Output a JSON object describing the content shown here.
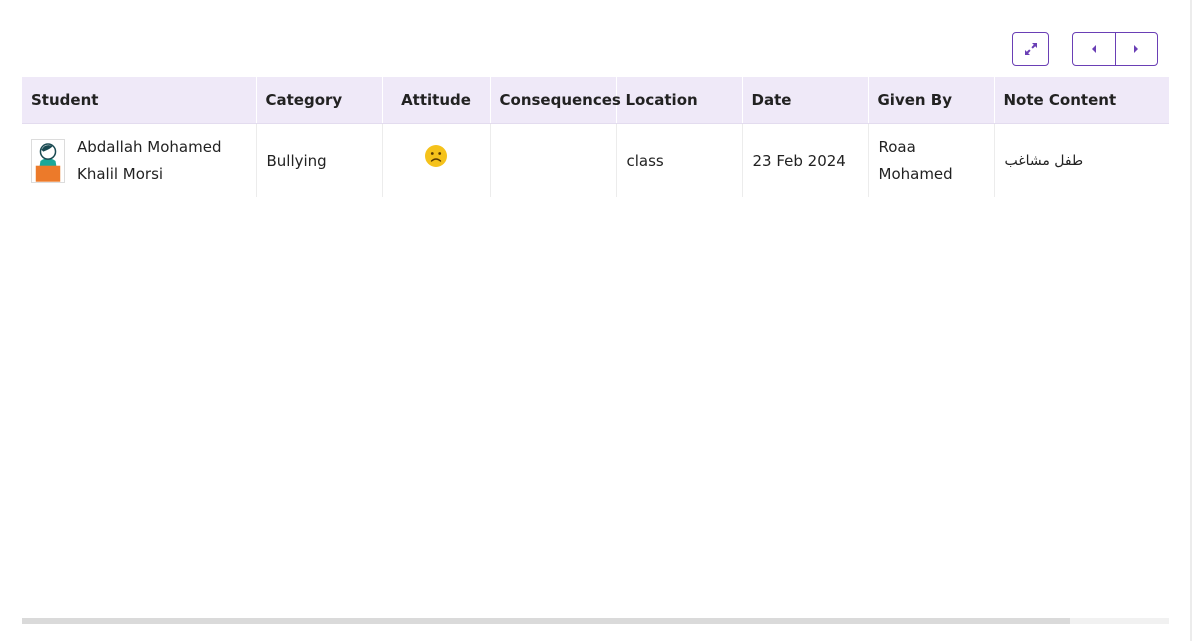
{
  "toolbar": {
    "expand_icon": "expand-arrows-icon",
    "prev_icon": "caret-left-icon",
    "next_icon": "caret-right-icon",
    "accent_color": "#6a3fb5"
  },
  "table": {
    "headers": {
      "student": "Student",
      "category": "Category",
      "attitude": "Attitude",
      "consequences": "Consequences",
      "location": "Location",
      "date": "Date",
      "given_by": "Given By",
      "note_content": "Note Content"
    },
    "rows": [
      {
        "student": "Abdallah Mohamed Khalil Morsi",
        "category": "Bullying",
        "attitude_icon": "sad-face-icon",
        "consequences": "",
        "location": "class",
        "date": "23 Feb 2024",
        "given_by": "Roaa Mohamed",
        "note_content": "طفل مشاغب"
      }
    ]
  },
  "colors": {
    "header_bg": "#efe9f8",
    "emoji_face": "#f5c21b"
  }
}
